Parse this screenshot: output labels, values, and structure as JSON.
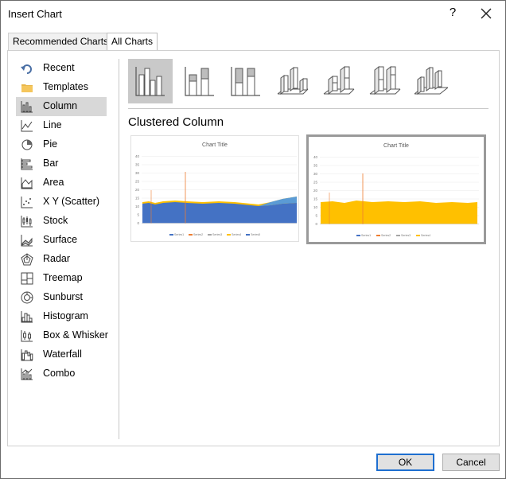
{
  "window": {
    "title": "Insert Chart",
    "help_glyph": "?"
  },
  "tabs": [
    {
      "label": "Recommended Charts",
      "active": false
    },
    {
      "label": "All Charts",
      "active": true
    }
  ],
  "nav": {
    "items": [
      {
        "label": "Recent",
        "icon": "undo-arrow-icon"
      },
      {
        "label": "Templates",
        "icon": "folder-icon"
      },
      {
        "label": "Column",
        "icon": "column-chart-icon",
        "selected": true
      },
      {
        "label": "Line",
        "icon": "line-chart-icon"
      },
      {
        "label": "Pie",
        "icon": "pie-chart-icon"
      },
      {
        "label": "Bar",
        "icon": "bar-chart-icon"
      },
      {
        "label": "Area",
        "icon": "area-chart-icon"
      },
      {
        "label": "X Y (Scatter)",
        "icon": "scatter-chart-icon"
      },
      {
        "label": "Stock",
        "icon": "stock-chart-icon"
      },
      {
        "label": "Surface",
        "icon": "surface-chart-icon"
      },
      {
        "label": "Radar",
        "icon": "radar-chart-icon"
      },
      {
        "label": "Treemap",
        "icon": "treemap-chart-icon"
      },
      {
        "label": "Sunburst",
        "icon": "sunburst-chart-icon"
      },
      {
        "label": "Histogram",
        "icon": "histogram-chart-icon"
      },
      {
        "label": "Box & Whisker",
        "icon": "box-whisker-chart-icon"
      },
      {
        "label": "Waterfall",
        "icon": "waterfall-chart-icon"
      },
      {
        "label": "Combo",
        "icon": "combo-chart-icon"
      }
    ]
  },
  "subtypes": [
    {
      "icon": "clustered-column-icon",
      "selected": true
    },
    {
      "icon": "stacked-column-icon"
    },
    {
      "icon": "100-stacked-column-icon"
    },
    {
      "icon": "3d-clustered-column-icon"
    },
    {
      "icon": "3d-stacked-column-icon"
    },
    {
      "icon": "3d-100-stacked-column-icon"
    },
    {
      "icon": "3d-column-icon"
    }
  ],
  "selected_type_title": "Clustered Column",
  "previews": [
    {
      "chart_title": "Chart Title",
      "y_ticks": [
        "40",
        "35",
        "30",
        "25",
        "20",
        "15",
        "10",
        "5",
        "0"
      ],
      "legend": [
        "Series1",
        "Series2",
        "Series3",
        "Series4",
        "Series5"
      ],
      "legend_colors": [
        "#4472c4",
        "#ed7d31",
        "#a5a5a5",
        "#ffc000",
        "#4472c4"
      ]
    },
    {
      "chart_title": "Chart Title",
      "y_ticks": [
        "40",
        "35",
        "30",
        "25",
        "20",
        "15",
        "10",
        "5",
        "0"
      ],
      "legend": [
        "Series1",
        "Series2",
        "Series3",
        "Series4"
      ],
      "legend_colors": [
        "#4472c4",
        "#ed7d31",
        "#a5a5a5",
        "#ffc000"
      ]
    }
  ],
  "buttons": {
    "ok": "OK",
    "cancel": "Cancel"
  },
  "colors": {
    "blue": "#4472c4",
    "orange": "#ed7d31",
    "gray": "#a5a5a5",
    "gold": "#ffc000",
    "accent": "#1e6fd0"
  }
}
